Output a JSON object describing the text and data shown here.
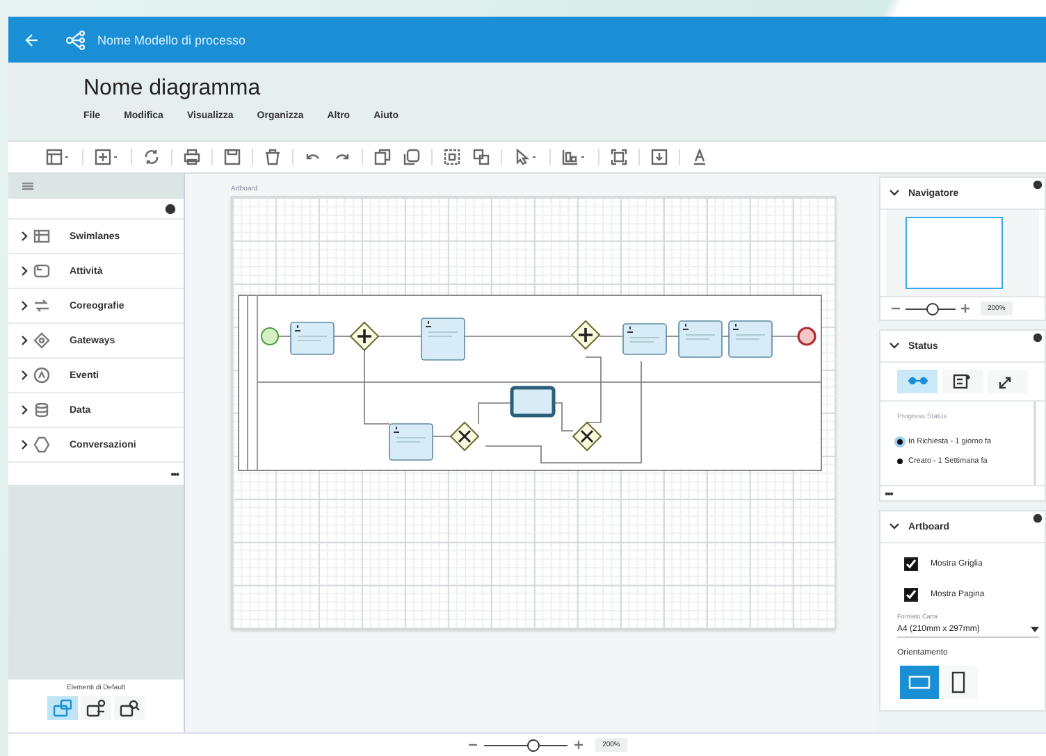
{
  "app_bar": {
    "title": "Nome Modello di processo"
  },
  "document": {
    "title": "Nome diagramma"
  },
  "menu": [
    "File",
    "Modifica",
    "Visualizza",
    "Organizza",
    "Altro",
    "Aiuto"
  ],
  "palette": {
    "items": [
      {
        "label": "Swimlanes",
        "expanded": false
      },
      {
        "label": "Attività",
        "expanded": false
      },
      {
        "label": "Coreografie",
        "expanded": false
      },
      {
        "label": "Gateways",
        "expanded": false
      },
      {
        "label": "Eventi",
        "expanded": false
      },
      {
        "label": "Data",
        "expanded": false
      },
      {
        "label": "Conversazioni",
        "expanded": false
      }
    ],
    "more": "•••",
    "footer": {
      "label": "Elementi di Default",
      "modes": [
        {
          "selected": true
        },
        {
          "selected": false
        },
        {
          "selected": false
        }
      ]
    }
  },
  "canvas": {
    "label": "Artboard"
  },
  "zoom": {
    "level": 0.6,
    "reading": "200%"
  },
  "navigator": {
    "title": "Navigatore",
    "expanded": true,
    "zoom": {
      "level": 0.55,
      "reading": "200%"
    }
  },
  "status": {
    "title": "Status",
    "expanded": true,
    "tabs": [
      {
        "selected": true
      },
      {
        "selected": false
      },
      {
        "selected": false
      }
    ],
    "heading": "Progress Status",
    "steps": [
      {
        "label": "In Richiesta - 1 giorno fa",
        "selected": true
      },
      {
        "label": "Creato - 1 Settimana fa",
        "selected": false
      }
    ],
    "more": "•••"
  },
  "artboard": {
    "title": "Artboard",
    "expanded": true,
    "options": [
      {
        "label": "Mostra Griglia",
        "checked": true
      },
      {
        "label": "Mostra Pagina",
        "checked": true
      }
    ],
    "paper": {
      "label": "Formato Carta",
      "value": "A4 (210mm x 297mm)"
    },
    "orientation": {
      "label": "Orientamento",
      "options": [
        {
          "kind": "landscape",
          "selected": true
        },
        {
          "kind": "portrait",
          "selected": false
        }
      ]
    }
  }
}
